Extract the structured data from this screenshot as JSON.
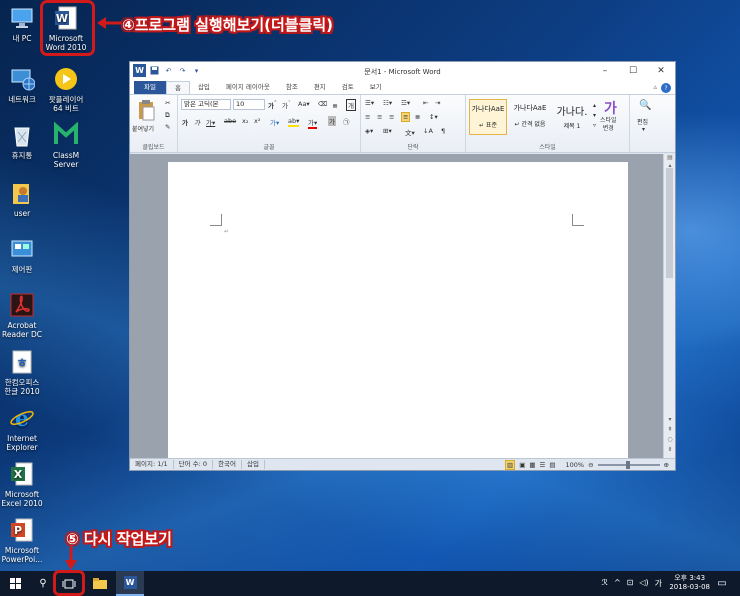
{
  "desktop_icons": [
    {
      "name": "내 PC",
      "icon": "this-pc-icon"
    },
    {
      "name": "Microsoft\nWord 2010",
      "icon": "word-icon"
    },
    {
      "name": "네트워크",
      "icon": "network-icon"
    },
    {
      "name": "팟플레이어\n64 비트",
      "icon": "potplayer-icon"
    },
    {
      "name": "휴지통",
      "icon": "recycle-bin-icon"
    },
    {
      "name": "ClassM\nServer",
      "icon": "classm-icon"
    },
    {
      "name": "user",
      "icon": "user-folder-icon"
    },
    {
      "name": "제어판",
      "icon": "control-panel-icon"
    },
    {
      "name": "Acrobat\nReader DC",
      "icon": "acrobat-icon"
    },
    {
      "name": "한컴오피스\n한글 2010",
      "icon": "hwp-icon"
    },
    {
      "name": "Internet\nExplorer",
      "icon": "ie-icon"
    },
    {
      "name": "Microsoft\nExcel 2010",
      "icon": "excel-icon"
    },
    {
      "name": "Microsoft\nPowerPoi...",
      "icon": "powerpoint-icon"
    }
  ],
  "annotations": {
    "step4": "④프로그램 실행해보기(더블클릭)",
    "step5": "⑤ 다시 작업보기"
  },
  "word": {
    "title": "문서1 - Microsoft Word",
    "tabs": [
      "파일",
      "홈",
      "삽입",
      "페이지 레이아웃",
      "참조",
      "편지",
      "검토",
      "보기"
    ],
    "active_tab": "홈",
    "groups": {
      "clipboard": "클립보드",
      "font": "글꼴",
      "paragraph": "단락",
      "styles": "스타일",
      "editing": "편집"
    },
    "paste_label": "붙여넣기",
    "font_name": "맑은 고딕(본",
    "font_size": "10",
    "styles": [
      {
        "preview": "가나다AaE",
        "name": "↵ 표준"
      },
      {
        "preview": "가나다AaE",
        "name": "↵ 간격 없음"
      },
      {
        "preview": "가나다.",
        "name": "제목 1"
      }
    ],
    "style_change": "스타일\n변경",
    "edit_label": "편집",
    "status": {
      "page": "페이지: 1/1",
      "words": "단어 수: 0",
      "language": "한국어",
      "mode": "삽입",
      "zoom": "100%"
    }
  },
  "taskbar": {
    "time": "오후 3:43",
    "date": "2018-03-08",
    "ime": "가"
  },
  "colors": {
    "annotation_red": "#c41818",
    "word_blue": "#2b579a"
  }
}
